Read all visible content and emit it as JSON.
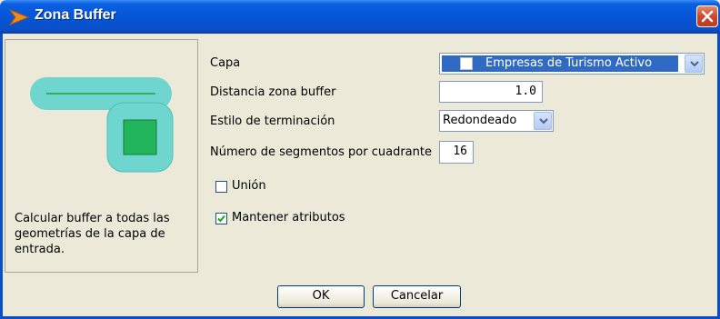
{
  "window": {
    "title": "Zona Buffer",
    "icon": "app-arrow-icon",
    "close_icon": "close-icon"
  },
  "side_panel": {
    "description": "Calcular buffer a todas las geometrías de la capa de entrada."
  },
  "form": {
    "layer_label": "Capa",
    "layer_value": "Empresas de Turismo Activo",
    "distance_label": "Distancia zona buffer",
    "distance_value": "1.0",
    "end_style_label": "Estilo de terminación",
    "end_style_value": "Redondeado",
    "segments_label": "Número de segmentos por cuadrante",
    "segments_value": "16",
    "union_label": "Unión",
    "union_checked": false,
    "keep_attributes_label": "Mantener atributos",
    "keep_attributes_checked": true
  },
  "buttons": {
    "ok": "OK",
    "cancel": "Cancelar"
  },
  "colors": {
    "titlebar": "#0556d8",
    "buffer_fill": "#6fd6cf",
    "square_fill": "#22b45a"
  }
}
